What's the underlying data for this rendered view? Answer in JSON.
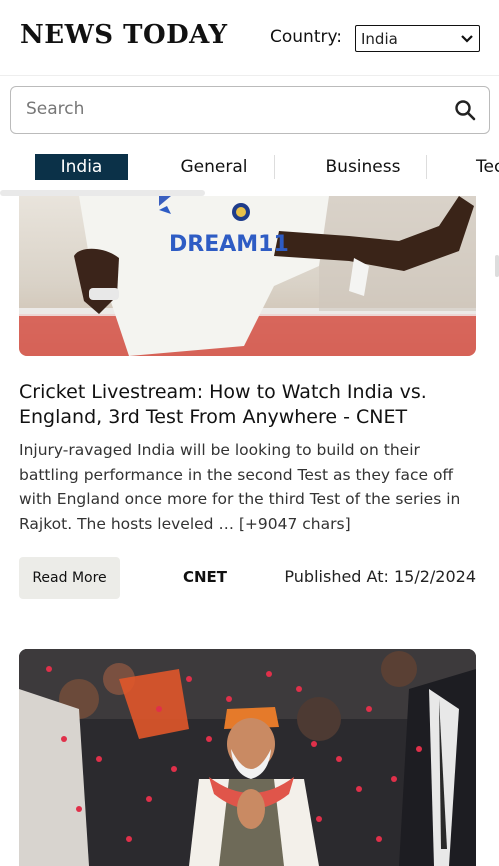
{
  "header": {
    "logo": "NEWS TODAY",
    "country_label": "Country:",
    "country_value": "India"
  },
  "search": {
    "placeholder": "Search"
  },
  "tabs": [
    {
      "label": "India",
      "active": true
    },
    {
      "label": "General"
    },
    {
      "label": "Business"
    },
    {
      "label": "Tec"
    }
  ],
  "articles": [
    {
      "title": "Cricket Livestream: How to Watch India vs. England, 3rd Test From Anywhere - CNET",
      "description": "Injury-ravaged India will be looking to build on their battling performance in the second Test as they face off with England once more for the third Test of the series in Rajkot.  The hosts leveled … [+9047 chars]",
      "read_more": "Read More",
      "source": "CNET",
      "published": "Published At: 15/2/2024",
      "jersey_text": "DREAM11"
    }
  ],
  "colors": {
    "active_tab": "#0b3148",
    "read_more_bg": "#ecece8"
  }
}
